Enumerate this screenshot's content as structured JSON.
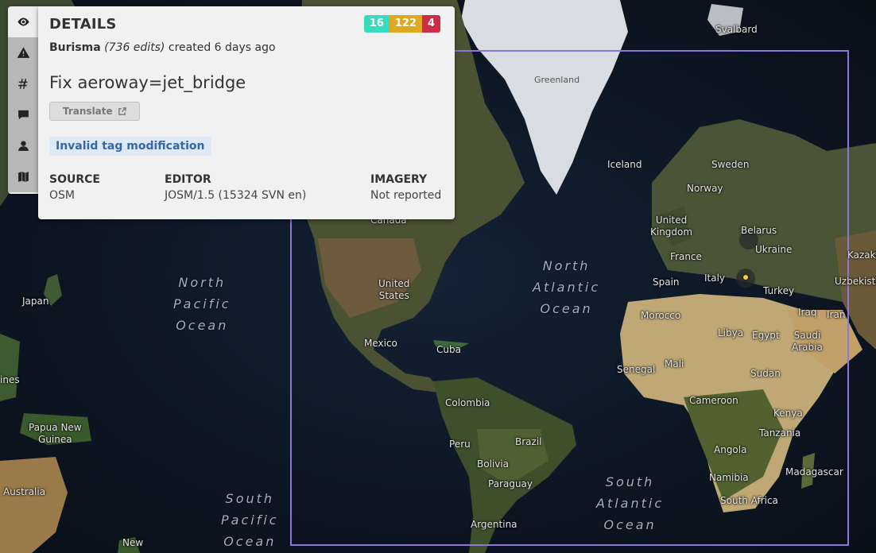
{
  "panel": {
    "title": "DETAILS",
    "counts": {
      "added": "16",
      "modified": "122",
      "deleted": "4"
    },
    "counts_colors": {
      "added": "#39dbc0",
      "modified": "#dfa820",
      "deleted": "#cc2c47"
    },
    "user": "Burisma",
    "edits": "(736 edits)",
    "created": "created 6 days ago",
    "comment": "Fix aeroway=jet_bridge",
    "translate_label": "Translate",
    "reason_tag": "Invalid tag modification",
    "source": {
      "label": "SOURCE",
      "value": "OSM"
    },
    "editor": {
      "label": "EDITOR",
      "value": "JOSM/1.5 (15324 SVN en)"
    },
    "imagery": {
      "label": "IMAGERY",
      "value": "Not reported"
    }
  },
  "side_tabs": [
    {
      "name": "eye-icon"
    },
    {
      "name": "warning-icon"
    },
    {
      "name": "hashtag-icon"
    },
    {
      "name": "comment-icon"
    },
    {
      "name": "user-icon"
    },
    {
      "name": "map-icon"
    }
  ],
  "map": {
    "bbox_color": "#8c78d6",
    "labels": {
      "svalbard": "Svalbard",
      "greenland": "Greenland",
      "iceland": "Iceland",
      "sweden": "Sweden",
      "norway": "Norway",
      "united_kingdom": "United\nKingdom",
      "belarus": "Belarus",
      "ukraine": "Ukraine",
      "kazakh": "Kazakh",
      "france": "France",
      "spain": "Spain",
      "italy": "Italy",
      "turkey": "Turkey",
      "uzbekista": "Uzbekista",
      "iraq": "Iraq",
      "iran": "Iran",
      "morocco": "Morocco",
      "libya": "Libya",
      "egypt": "Egypt",
      "saudi_arabia": "Saudi\nArabia",
      "mali": "Mali",
      "senegal": "Senegal",
      "sudan": "Sudan",
      "cameroon": "Cameroon",
      "kenya": "Kenya",
      "tanzania": "Tanzania",
      "angola": "Angola",
      "namibia": "Namibia",
      "south_africa": "South Africa",
      "madagascar": "Madagascar",
      "canada": "Canada",
      "united_states": "United\nStates",
      "mexico": "Mexico",
      "cuba": "Cuba",
      "colombia": "Colombia",
      "peru": "Peru",
      "brazil": "Brazil",
      "bolivia": "Bolivia",
      "paraguay": "Paraguay",
      "argentina": "Argentina",
      "japan": "Japan",
      "papua_new_guinea": "Papua New\nGuinea",
      "australia": "Australia",
      "new_zealand": "New",
      "ines": "ines"
    },
    "oceans": {
      "north_pacific": "North\nPacific\nOcean",
      "north_atlantic": "North\nAtlantic\nOcean",
      "south_atlantic": "South\nAtlantic\nOcean",
      "south_pacific": "South\nPacific\nOcean"
    }
  }
}
